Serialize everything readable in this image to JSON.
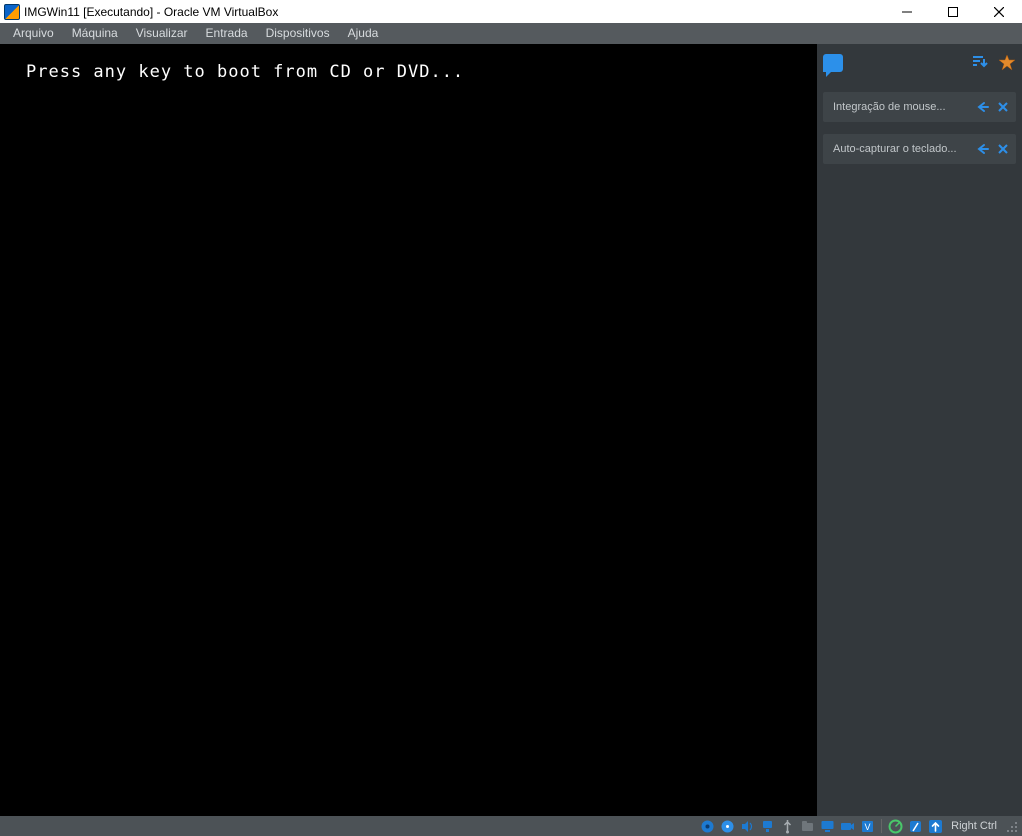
{
  "titlebar": {
    "text": "IMGWin11 [Executando] - Oracle VM VirtualBox"
  },
  "menubar": {
    "items": [
      "Arquivo",
      "Máquina",
      "Visualizar",
      "Entrada",
      "Dispositivos",
      "Ajuda"
    ]
  },
  "vm": {
    "console_text": "Press any key to boot from CD or DVD..."
  },
  "notifications": {
    "items": [
      {
        "label": "Integração de mouse..."
      },
      {
        "label": "Auto-capturar o teclado..."
      }
    ]
  },
  "statusbar": {
    "host_key_label": "Right Ctrl",
    "icons": [
      "hard-disk-icon",
      "optical-disc-icon",
      "audio-icon",
      "network-icon",
      "usb-icon",
      "shared-folder-icon",
      "display-icon",
      "recording-icon",
      "video-capture-icon",
      "cpu-activity-icon",
      "mouse-integration-icon",
      "keyboard-capture-icon"
    ]
  }
}
